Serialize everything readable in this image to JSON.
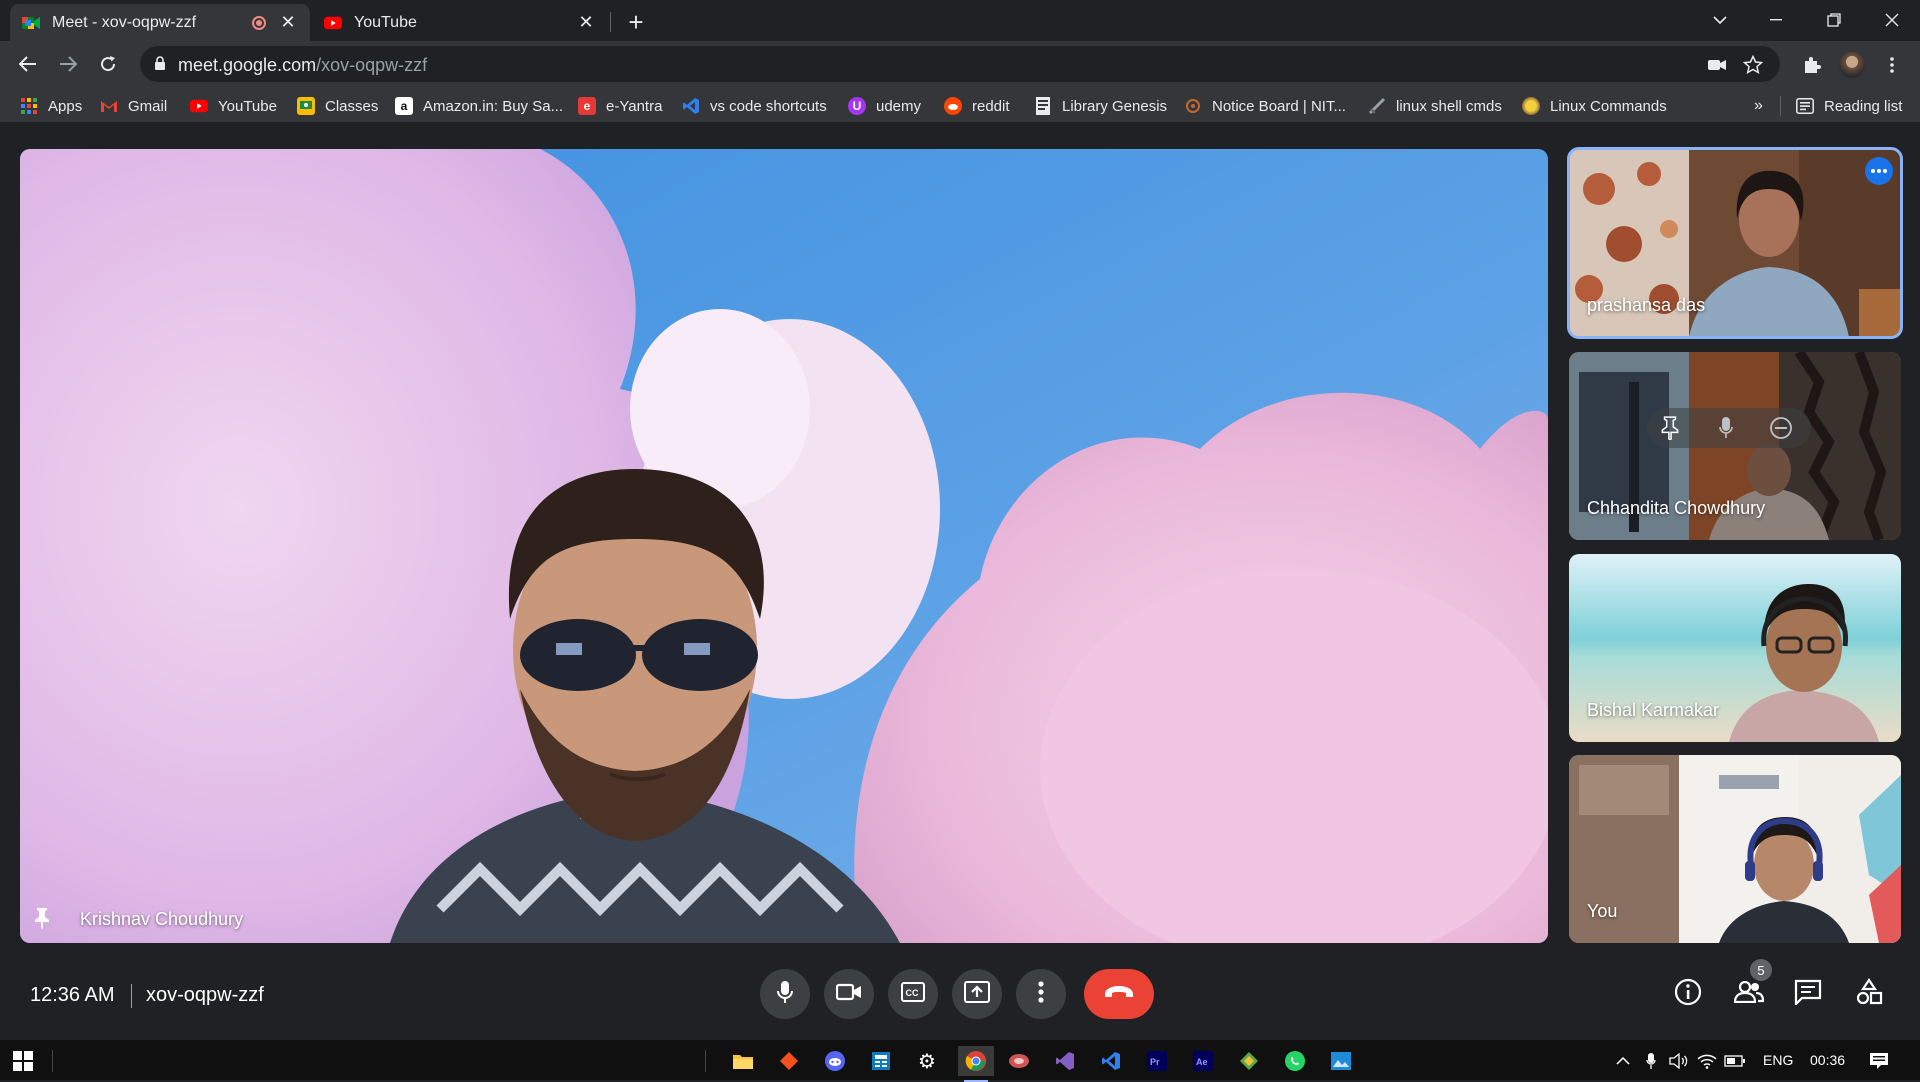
{
  "browser": {
    "tabs": [
      {
        "title": "Meet - xov-oqpw-zzf",
        "active": true,
        "recording": true
      },
      {
        "title": "YouTube",
        "active": false
      }
    ],
    "url_host": "meet.google.com",
    "url_path": "/xov-oqpw-zzf",
    "bookmarks": [
      {
        "label": "Apps",
        "icon": "apps-grid-icon"
      },
      {
        "label": "Gmail",
        "icon": "gmail-icon"
      },
      {
        "label": "YouTube",
        "icon": "youtube-icon"
      },
      {
        "label": "Classes",
        "icon": "classroom-icon"
      },
      {
        "label": "Amazon.in: Buy Sa...",
        "icon": "amazon-icon"
      },
      {
        "label": "e-Yantra",
        "icon": "eyantra-icon"
      },
      {
        "label": "vs code shortcuts",
        "icon": "vscode-icon"
      },
      {
        "label": "udemy",
        "icon": "udemy-icon"
      },
      {
        "label": "reddit",
        "icon": "reddit-icon"
      },
      {
        "label": "Library Genesis",
        "icon": "document-icon"
      },
      {
        "label": "Notice Board | NIT...",
        "icon": "nit-icon"
      },
      {
        "label": "linux shell cmds",
        "icon": "shell-icon"
      },
      {
        "label": "Linux Commands",
        "icon": "linux-icon"
      }
    ],
    "bookmarks_overflow": "»",
    "reading_list": "Reading list"
  },
  "meet": {
    "main_participant": "Krishnav Choudhury",
    "participants": [
      {
        "name": "prashansa das",
        "speaking": true
      },
      {
        "name": "Chhandita Chowdhury",
        "hover": true
      },
      {
        "name": "Bishal Karmakar"
      },
      {
        "name": "You"
      }
    ],
    "time": "12:36 AM",
    "meeting_code": "xov-oqpw-zzf",
    "participant_count": "5"
  },
  "taskbar": {
    "language": "ENG",
    "clock": "00:36"
  },
  "colors": {
    "hangup": "#ea4335",
    "speaker_outline": "#8ab4f8",
    "meet_bg": "#202124"
  }
}
